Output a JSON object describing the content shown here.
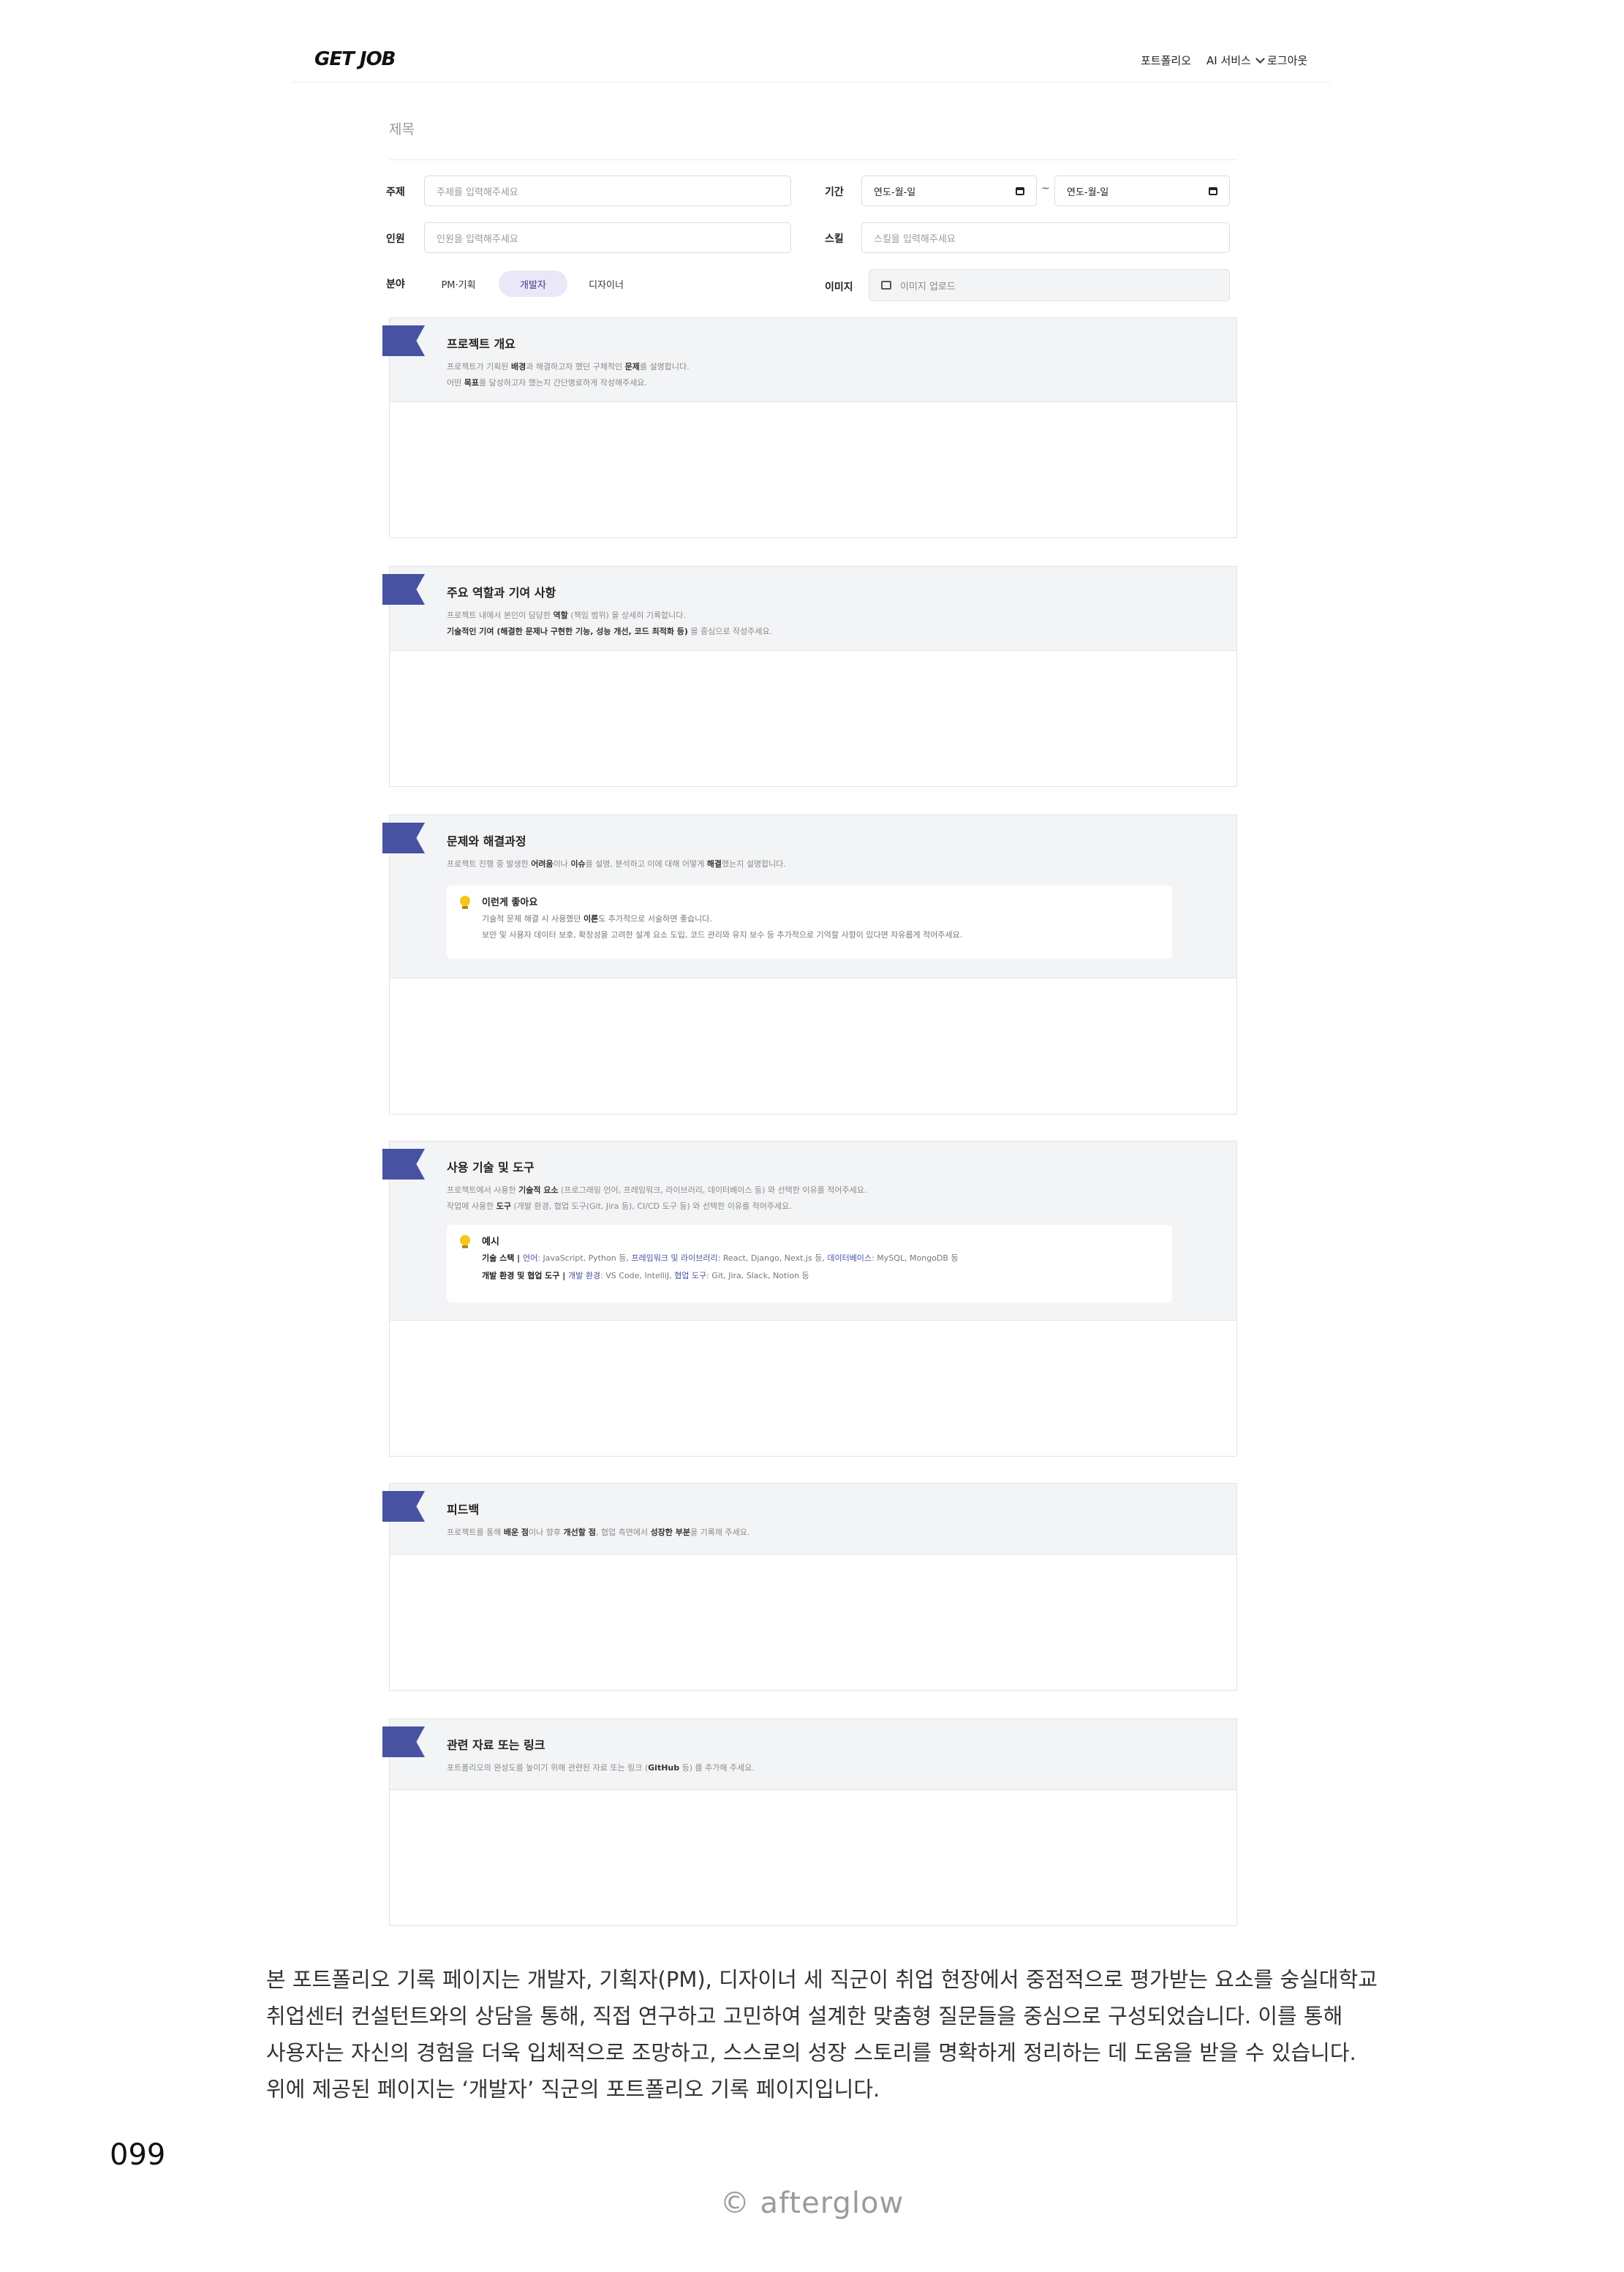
{
  "header": {
    "logo": "GET JOB",
    "nav_portfolio": "포트폴리오",
    "nav_ai": "AI 서비스",
    "nav_logout": "로그아웃"
  },
  "form": {
    "title_placeholder": "제목",
    "topic_label": "주제",
    "topic_placeholder": "주제를 입력해주세요",
    "members_label": "인원",
    "members_placeholder": "인원을 입력해주세요",
    "field_label": "분야",
    "field_options": [
      "PM·기획",
      "개발자",
      "디자이너"
    ],
    "field_selected": "개발자",
    "period_label": "기간",
    "date_start": "연도-월-일",
    "date_sep": "~",
    "date_end": "연도-월-일",
    "skill_label": "스킬",
    "skill_placeholder": "스킬을 입력해주세요",
    "image_label": "이미지",
    "image_upload": "이미지 업로드"
  },
  "sections": {
    "s1": {
      "title": "프로젝트 개요",
      "line1_a": "프로젝트가 기획된 ",
      "line1_b": "배경",
      "line1_c": "과 해결하고자 했던 구체적인 ",
      "line1_d": "문제",
      "line1_e": "를 설명합니다.",
      "line2_a": "어떤 ",
      "line2_b": "목표",
      "line2_c": "를 달성하고자 했는지 간단명료하게 작성해주세요."
    },
    "s2": {
      "title": "주요 역할과 기여 사항",
      "line1_a": "프로젝트 내에서 본인이 담당한 ",
      "line1_b": "역할",
      "line1_c": " (책임 범위) 을 상세히 기록합니다.",
      "line2_a": "기술적인 기여 (해결한 문제나 구현한 기능, 성능 개선, 코드 최적화 등)",
      "line2_b": " 을 중심으로 작성주세요."
    },
    "s3": {
      "title": "문제와 해결과정",
      "line1_a": "프로젝트 진행 중 발생한 ",
      "line1_b": "어려움",
      "line1_c": "이나 ",
      "line1_d": "이슈",
      "line1_e": "를 설명, 분석하고 이에 대해 어떻게 ",
      "line1_f": "해결",
      "line1_g": "했는지 설명합니다.",
      "tip_title": "이런게 좋아요",
      "tip1_a": "기술적 문제 해결 시 사용했던 ",
      "tip1_b": "이론",
      "tip1_c": "도 추가적으로 서술하면 좋습니다.",
      "tip2": "보안 및 사용자 데이터 보호, 확장성을 고려한 설계 요소 도입, 코드 관리와 유지 보수 등 추가적으로 기억할 사항이 있다면 자유롭게 적어주세요."
    },
    "s4": {
      "title": "사용 기술 및 도구",
      "line1_a": "프로젝트에서 사용한 ",
      "line1_b": "기술적 요소",
      "line1_c": " (프로그래밍 언어, 프레임워크, 라이브러리, 데이터베이스 등) 와 선택한 이유를 적어주세요.",
      "line2_a": "작업에 사용한 ",
      "line2_b": "도구",
      "line2_c": " (개발 환경, 협업 도구(Git, Jira 등), CI/CD 도구 등) 와 선택한 이유를 적어주세요.",
      "tip_title": "예시",
      "ex1_a": "기술 스택 | ",
      "ex1_b": "언어",
      "ex1_c": ": JavaScript, Python 등, ",
      "ex1_d": "프레임워크 및 라이브러리",
      "ex1_e": ": React, Django, Next.js 등, ",
      "ex1_f": "데이터베이스",
      "ex1_g": ": MySQL, MongoDB 등",
      "ex2_a": "개발 환경 및 협업 도구 | ",
      "ex2_b": "개발 환경",
      "ex2_c": ": VS Code, IntelliJ, ",
      "ex2_d": "협업 도구",
      "ex2_e": ": Git, Jira, Slack, Notion 등"
    },
    "s5": {
      "title": "피드백",
      "line1_a": "프로젝트를 통해 ",
      "line1_b": "배운 점",
      "line1_c": "이나 향후 ",
      "line1_d": "개선할 점",
      "line1_e": ", 협업 측면에서 ",
      "line1_f": "성장한 부분",
      "line1_g": "을 기록해 주세요."
    },
    "s6": {
      "title": "관련 자료 또는 링크",
      "line1_a": "포트폴리오의 완성도를 높이기 위해 관련된 자료 또는 링크 (",
      "line1_b": "GitHub",
      "line1_c": " 등) 를 추가해 주세요."
    }
  },
  "caption": {
    "line1": "본 포트폴리오 기록 페이지는 개발자, 기획자(PM), 디자이너 세 직군이 취업 현장에서 중점적으로 평가받는 요소를 숭실대학교",
    "line2": "취업센터 컨설턴트와의 상담을 통해, 직접 연구하고 고민하여 설계한 맞춤형 질문들을 중심으로 구성되었습니다. 이를 통해",
    "line3": "사용자는 자신의 경험을 더욱 입체적으로 조망하고, 스스로의 성장 스토리를 명확하게 정리하는 데 도움을 받을 수 있습니다.",
    "line4": "위에 제공된 페이지는 ‘개발자’ 직군의 포트폴리오 기록 페이지입니다."
  },
  "page_number": "099",
  "credit": "© afterglow",
  "colors": {
    "accent": "#4752a3",
    "chip_active_bg": "#e9e7f8",
    "section_head_bg": "#f3f4f6"
  }
}
